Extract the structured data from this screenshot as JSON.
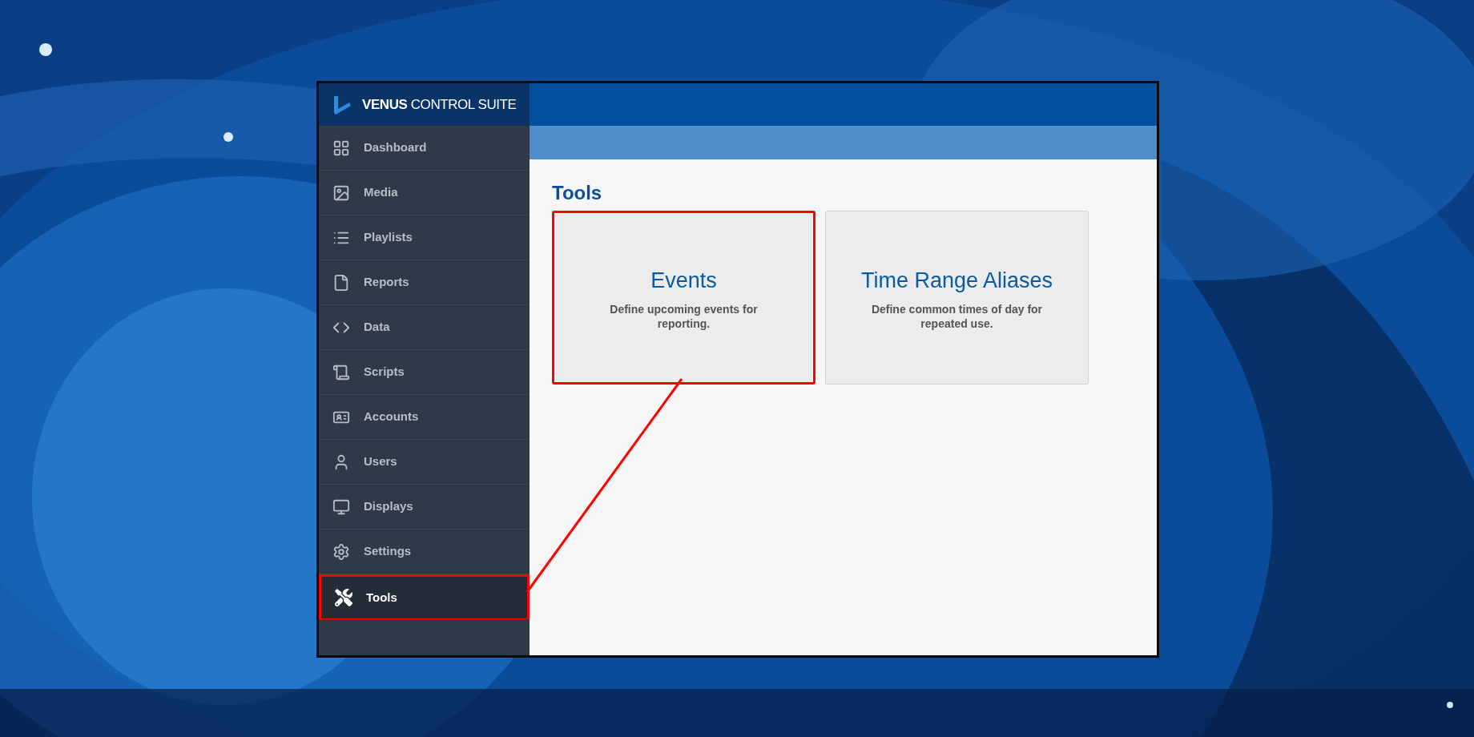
{
  "sidebar": {
    "brand": "**VENUS** CONTROL SUITE",
    "items": [
      {
        "label": "Dashboard",
        "selected": false,
        "highlighted": false
      },
      {
        "label": "Media",
        "selected": false,
        "highlighted": false
      },
      {
        "label": "Playlists",
        "selected": false,
        "highlighted": false
      },
      {
        "label": "Reports",
        "selected": false,
        "highlighted": false
      },
      {
        "label": "Data",
        "selected": false,
        "highlighted": false
      },
      {
        "label": "Scripts",
        "selected": false,
        "highlighted": false
      },
      {
        "label": "Accounts",
        "selected": false,
        "highlighted": false
      },
      {
        "label": "Users",
        "selected": false,
        "highlighted": false
      },
      {
        "label": "Displays",
        "selected": false,
        "highlighted": false
      },
      {
        "label": "Settings",
        "selected": false,
        "highlighted": false
      },
      {
        "label": "Tools",
        "selected": true,
        "highlighted": true
      }
    ]
  },
  "page": {
    "title": "Tools",
    "cards": [
      {
        "title": "Events",
        "description": "Define upcoming events for reporting.",
        "highlighted": true
      },
      {
        "title": "Time Range Aliases",
        "description": "Define common times of day for repeated use.",
        "highlighted": false
      }
    ]
  },
  "callout": {
    "visible": true
  }
}
